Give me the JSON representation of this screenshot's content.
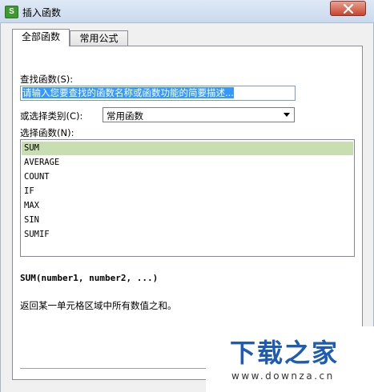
{
  "window": {
    "title": "插入函数",
    "app_icon_letter": "S"
  },
  "tabs": [
    {
      "label": "全部函数",
      "active": true
    },
    {
      "label": "常用公式",
      "active": false
    }
  ],
  "search": {
    "label": "查找函数(S):",
    "value": "请输入您要查找的函数名称或函数功能的简要描述..."
  },
  "category": {
    "label": "或选择类别(C):",
    "selected": "常用函数"
  },
  "function_list": {
    "label": "选择函数(N):",
    "items": [
      "SUM",
      "AVERAGE",
      "COUNT",
      "IF",
      "MAX",
      "SIN",
      "SUMIF"
    ],
    "selected_index": 0
  },
  "details": {
    "syntax": "SUM(number1, number2, ...)",
    "description": "返回某一单元格区域中所有数值之和。"
  },
  "watermark": {
    "title": "下载之家",
    "url": "www.downza.cn"
  },
  "colors": {
    "selection": "#c8ddb0",
    "input_highlight": "#3399ff",
    "watermark": "#1e5bb5",
    "close_button": "#c7442d"
  }
}
